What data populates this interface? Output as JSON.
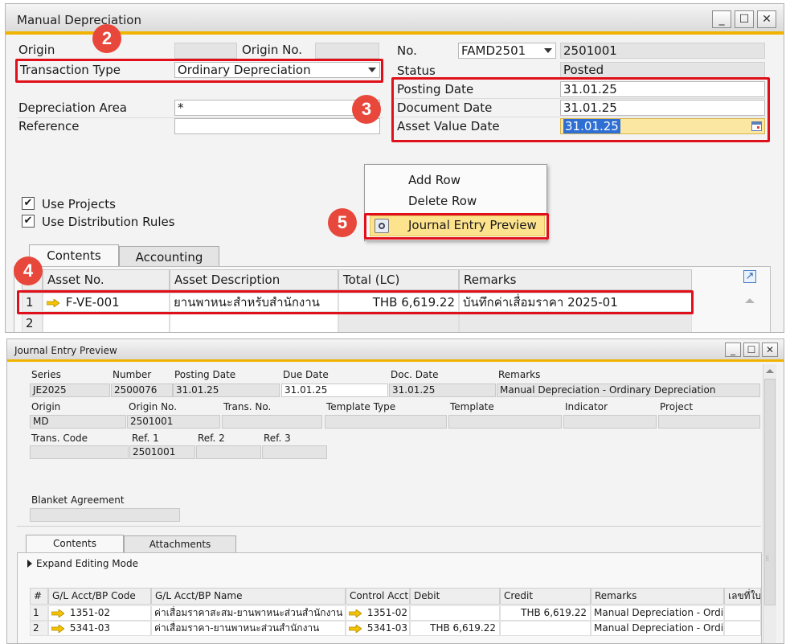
{
  "top_window": {
    "title": "Manual Depreciation",
    "controls": {
      "minimize": "_",
      "maximize": "☐",
      "close": "✕"
    },
    "header": {
      "origin_label": "Origin",
      "origin_no_label": "Origin No.",
      "transaction_type_label": "Transaction Type",
      "transaction_type_value": "Ordinary Depreciation",
      "depreciation_area_label": "Depreciation Area",
      "depreciation_area_value": "*",
      "reference_label": "Reference",
      "no_label": "No.",
      "series_value": "FAMD2501",
      "number_value": "2501001",
      "status_label": "Status",
      "status_value": "Posted",
      "posting_date_label": "Posting Date",
      "posting_date_value": "31.01.25",
      "document_date_label": "Document Date",
      "document_date_value": "31.01.25",
      "asset_value_date_label": "Asset Value Date",
      "asset_value_date_value": "31.01.25"
    },
    "options": {
      "use_projects": "Use Projects",
      "use_distribution_rules": "Use Distribution Rules"
    },
    "context_menu": {
      "items": [
        "Add Row",
        "Delete Row",
        "Journal Entry Preview"
      ],
      "highlighted": "Journal Entry Preview"
    },
    "tabs": [
      "Contents",
      "Accounting"
    ],
    "grid": {
      "columns": [
        "#",
        "Asset No.",
        "Asset Description",
        "Total (LC)",
        "Remarks"
      ],
      "rows": [
        {
          "num": "1",
          "asset_no": "F-VE-001",
          "description": "ยานพาหนะสำหรับสำนักงาน",
          "total": "THB 6,619.22",
          "remarks": "บันทึกค่าเสื่อมราคา 2025-01"
        },
        {
          "num": "2",
          "asset_no": "",
          "description": "",
          "total": "",
          "remarks": ""
        }
      ]
    },
    "badges": {
      "b2": "2",
      "b3": "3",
      "b4": "4",
      "b5": "5"
    }
  },
  "bottom_window": {
    "title": "Journal Entry Preview",
    "controls": {
      "minimize": "_",
      "maximize": "☐",
      "close": "✕"
    },
    "fields": {
      "series_label": "Series",
      "series_value": "JE2025",
      "number_label": "Number",
      "number_value": "2500076",
      "posting_date_label": "Posting Date",
      "posting_date_value": "31.01.25",
      "due_date_label": "Due Date",
      "due_date_value": "31.01.25",
      "doc_date_label": "Doc. Date",
      "doc_date_value": "31.01.25",
      "remarks_label": "Remarks",
      "remarks_value": "Manual Depreciation - Ordinary Depreciation",
      "origin_label": "Origin",
      "origin_value": "MD",
      "origin_no_label": "Origin No.",
      "origin_no_value": "2501001",
      "trans_no_label": "Trans. No.",
      "template_type_label": "Template Type",
      "template_label": "Template",
      "indicator_label": "Indicator",
      "project_label": "Project",
      "trans_code_label": "Trans. Code",
      "ref1_label": "Ref. 1",
      "ref1_value": "2501001",
      "ref2_label": "Ref. 2",
      "ref3_label": "Ref. 3",
      "blanket_agreement_label": "Blanket Agreement"
    },
    "tabs": [
      "Contents",
      "Attachments"
    ],
    "expand_label": "Expand Editing Mode",
    "grid": {
      "columns": [
        "#",
        "G/L Acct/BP Code",
        "G/L Acct/BP Name",
        "Control Acct",
        "Debit",
        "Credit",
        "Remarks",
        "เลขที่ใบ"
      ],
      "rows": [
        {
          "num": "1",
          "code": "1351-02",
          "name": "ค่าเสื่อมราคาสะสม-ยานพาหนะส่วนสำนักงาน",
          "control": "1351-02",
          "debit": "",
          "credit": "THB 6,619.22",
          "remarks": "Manual Depreciation - Ordina",
          "extra": ""
        },
        {
          "num": "2",
          "code": "5341-03",
          "name": "ค่าเสื่อมราคา-ยานพาหนะส่วนสำนักงาน",
          "control": "5341-03",
          "debit": "THB 6,619.22",
          "credit": "",
          "remarks": "Manual Depreciation - Ordina",
          "extra": ""
        }
      ]
    }
  },
  "colors": {
    "accent": "#f0b400",
    "highlight_red": "#e0101a",
    "badge": "#e8473b",
    "arrow_yellow": "#f5c400",
    "selection_blue": "#2f6fd3"
  }
}
